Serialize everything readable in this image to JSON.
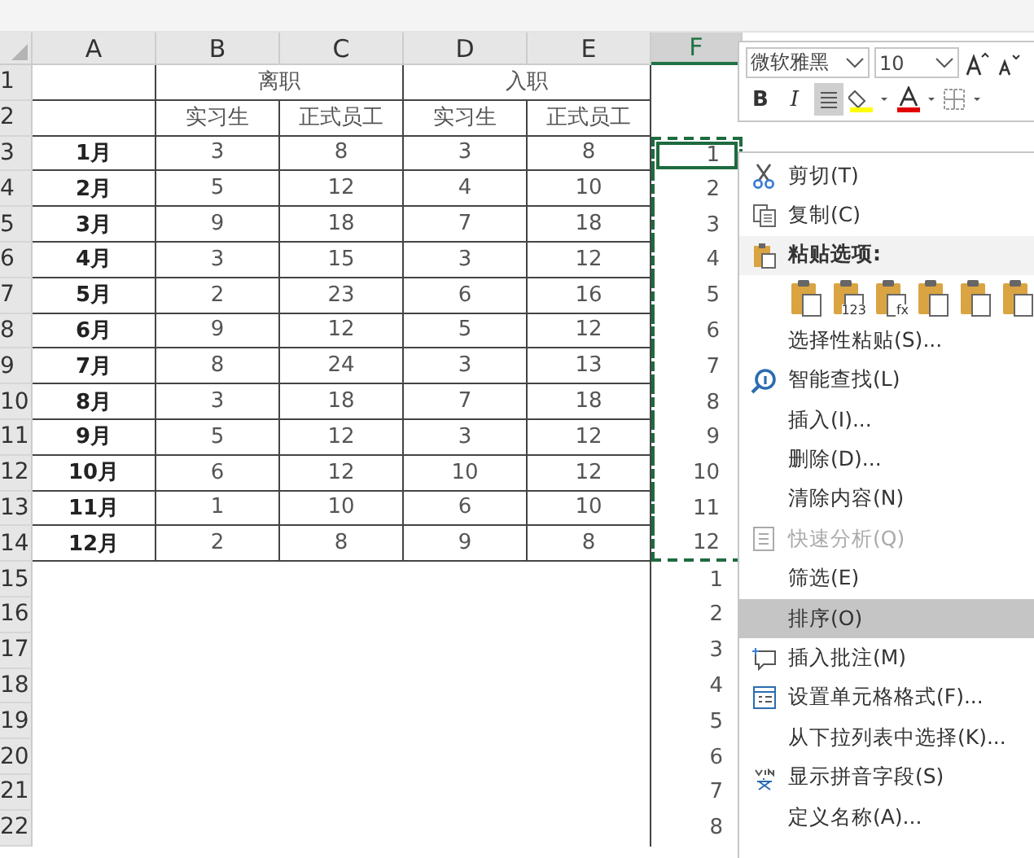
{
  "columns": [
    {
      "label": "A",
      "selected": false
    },
    {
      "label": "B",
      "selected": false
    },
    {
      "label": "C",
      "selected": false
    },
    {
      "label": "D",
      "selected": false
    },
    {
      "label": "E",
      "selected": false
    },
    {
      "label": "F",
      "selected": true
    }
  ],
  "row_numbers": [
    "1",
    "2",
    "3",
    "4",
    "5",
    "6",
    "7",
    "8",
    "9",
    "10",
    "11",
    "12",
    "13",
    "14",
    "15",
    "16",
    "17",
    "18",
    "19",
    "20",
    "21",
    "22"
  ],
  "group_headers": [
    "离职",
    "入职"
  ],
  "sub_headers": [
    "实习生",
    "正式员工",
    "实习生",
    "正式员工"
  ],
  "data_rows": [
    {
      "month": "1月",
      "values": [
        "3",
        "8",
        "3",
        "8"
      ]
    },
    {
      "month": "2月",
      "values": [
        "5",
        "12",
        "4",
        "10"
      ]
    },
    {
      "month": "3月",
      "values": [
        "9",
        "18",
        "7",
        "18"
      ]
    },
    {
      "month": "4月",
      "values": [
        "3",
        "15",
        "3",
        "12"
      ]
    },
    {
      "month": "5月",
      "values": [
        "2",
        "23",
        "6",
        "16"
      ]
    },
    {
      "month": "6月",
      "values": [
        "9",
        "12",
        "5",
        "12"
      ]
    },
    {
      "month": "7月",
      "values": [
        "8",
        "24",
        "3",
        "13"
      ]
    },
    {
      "month": "8月",
      "values": [
        "3",
        "18",
        "7",
        "18"
      ]
    },
    {
      "month": "9月",
      "values": [
        "5",
        "12",
        "3",
        "12"
      ]
    },
    {
      "month": "10月",
      "values": [
        "6",
        "12",
        "10",
        "12"
      ]
    },
    {
      "month": "11月",
      "values": [
        "1",
        "10",
        "6",
        "10"
      ]
    },
    {
      "month": "12月",
      "values": [
        "2",
        "8",
        "9",
        "8"
      ]
    }
  ],
  "column_f": [
    {
      "value": "1",
      "copied": true,
      "active": true
    },
    {
      "value": "2",
      "copied": true,
      "active": false
    },
    {
      "value": "3",
      "copied": true,
      "active": false
    },
    {
      "value": "4",
      "copied": true,
      "active": false
    },
    {
      "value": "5",
      "copied": true,
      "active": false
    },
    {
      "value": "6",
      "copied": true,
      "active": false
    },
    {
      "value": "7",
      "copied": true,
      "active": false
    },
    {
      "value": "8",
      "copied": true,
      "active": false
    },
    {
      "value": "9",
      "copied": true,
      "active": false
    },
    {
      "value": "10",
      "copied": true,
      "active": false
    },
    {
      "value": "11",
      "copied": true,
      "active": false
    },
    {
      "value": "12",
      "copied": true,
      "active": false
    },
    {
      "value": "1",
      "copied": false,
      "active": false
    },
    {
      "value": "2",
      "copied": false,
      "active": false
    },
    {
      "value": "3",
      "copied": false,
      "active": false
    },
    {
      "value": "4",
      "copied": false,
      "active": false
    },
    {
      "value": "5",
      "copied": false,
      "active": false
    },
    {
      "value": "6",
      "copied": false,
      "active": false
    },
    {
      "value": "7",
      "copied": false,
      "active": false
    },
    {
      "value": "8",
      "copied": false,
      "active": false
    }
  ],
  "mini_toolbar": {
    "font_name": "微软雅黑",
    "font_size": "10",
    "bold_label": "B",
    "italic_label": "I",
    "align_selected": true
  },
  "context_menu": [
    {
      "kind": "cut",
      "label": "剪切(T)",
      "disabled": false,
      "selected": false
    },
    {
      "kind": "copy",
      "label": "复制(C)",
      "disabled": false,
      "selected": false
    },
    {
      "kind": "paste-header",
      "label": "粘贴选项:",
      "disabled": false,
      "selected": false
    },
    {
      "kind": "paste-icons",
      "icons": [
        {
          "kind": "plain"
        },
        {
          "kind": "text",
          "label": "123"
        },
        {
          "kind": "text",
          "label": "fx"
        },
        {
          "kind": "swap"
        },
        {
          "kind": "percent"
        },
        {
          "kind": "plain"
        }
      ]
    },
    {
      "kind": "item",
      "label": "选择性粘贴(S)...",
      "disabled": false,
      "selected": false
    },
    {
      "kind": "lookup",
      "label": "智能查找(L)",
      "disabled": false,
      "selected": false
    },
    {
      "kind": "item",
      "label": "插入(I)...",
      "disabled": false,
      "selected": false
    },
    {
      "kind": "item",
      "label": "删除(D)...",
      "disabled": false,
      "selected": false
    },
    {
      "kind": "item",
      "label": "清除内容(N)",
      "disabled": false,
      "selected": false
    },
    {
      "kind": "analysis",
      "label": "快速分析(Q)",
      "disabled": true,
      "selected": false
    },
    {
      "kind": "item",
      "label": "筛选(E)",
      "disabled": false,
      "selected": false
    },
    {
      "kind": "item",
      "label": "排序(O)",
      "disabled": false,
      "selected": true
    },
    {
      "kind": "comment",
      "label": "插入批注(M)",
      "disabled": false,
      "selected": false
    },
    {
      "kind": "format",
      "label": "设置单元格格式(F)...",
      "disabled": false,
      "selected": false
    },
    {
      "kind": "item",
      "label": "从下拉列表中选择(K)...",
      "disabled": false,
      "selected": false
    },
    {
      "kind": "pinyin",
      "label": "显示拼音字段(S)",
      "disabled": false,
      "selected": false
    },
    {
      "kind": "item",
      "label": "定义名称(A)...",
      "disabled": false,
      "selected": false
    }
  ]
}
